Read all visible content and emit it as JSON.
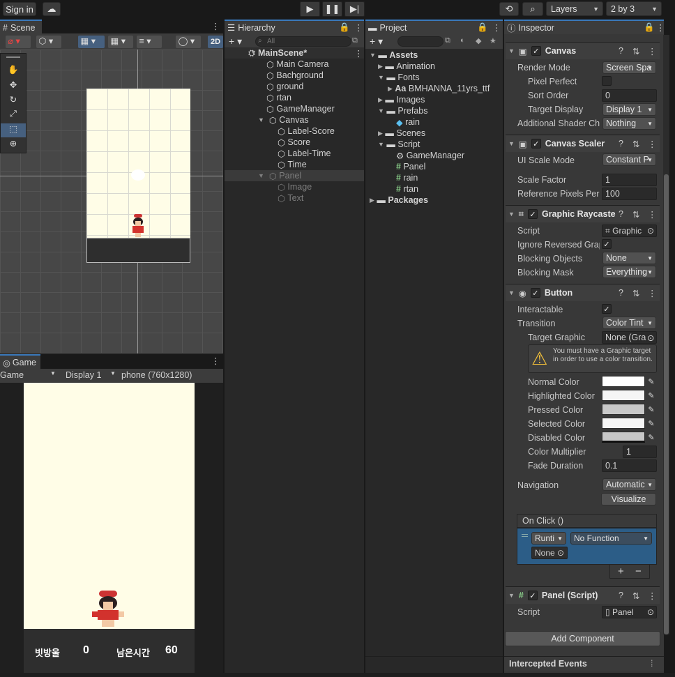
{
  "toolbar": {
    "sign_in": "Sign in",
    "layers": "Layers",
    "layout": "2 by 3"
  },
  "scene": {
    "tab": "Scene",
    "mode_2d": "2D"
  },
  "game": {
    "tab": "Game",
    "view": "Game",
    "display": "Display 1",
    "resolution": "phone (760x1280)",
    "hud": {
      "score_label": "빗방울",
      "score": "0",
      "time_label": "남은시간",
      "time": "60"
    }
  },
  "hierarchy": {
    "tab": "Hierarchy",
    "search_placeholder": "All",
    "scene_name": "MainScene*",
    "items": [
      "Main Camera",
      "Bachground",
      "ground",
      "rtan",
      "GameManager",
      "Canvas",
      "Label-Score",
      "Score",
      "Label-Time",
      "Time",
      "Panel",
      "Image",
      "Text"
    ]
  },
  "project": {
    "tab": "Project",
    "items": [
      "Assets",
      "Animation",
      "Fonts",
      "BMHANNA_11yrs_ttf",
      "Images",
      "Prefabs",
      "rain",
      "Scenes",
      "Script",
      "GameManager",
      "Panel",
      "rain",
      "rtan",
      "Packages"
    ],
    "font_prefix": "Aa"
  },
  "inspector": {
    "tab": "Inspector",
    "canvas": {
      "title": "Canvas",
      "render_mode_label": "Render Mode",
      "render_mode": "Screen Spa",
      "pixel_perfect": "Pixel Perfect",
      "sort_order_label": "Sort Order",
      "sort_order": "0",
      "target_display_label": "Target Display",
      "target_display": "Display 1",
      "shader_label": "Additional Shader Ch",
      "shader": "Nothing"
    },
    "scaler": {
      "title": "Canvas Scaler",
      "ui_scale_label": "UI Scale Mode",
      "ui_scale": "Constant P",
      "scale_factor_label": "Scale Factor",
      "scale_factor": "1",
      "ref_label": "Reference Pixels Per",
      "ref": "100"
    },
    "raycaster": {
      "title": "Graphic Raycaste",
      "script_label": "Script",
      "script": "Graphic",
      "ignore_label": "Ignore Reversed Grap",
      "blocking_label": "Blocking Objects",
      "blocking": "None",
      "mask_label": "Blocking Mask",
      "mask": "Everything"
    },
    "button": {
      "title": "Button",
      "interactable": "Interactable",
      "transition_label": "Transition",
      "transition": "Color Tint",
      "target_label": "Target Graphic",
      "target": "None (Gra",
      "warning": "You must have a Graphic target in order to use a color transition.",
      "normal": "Normal Color",
      "highlighted": "Highlighted Color",
      "pressed": "Pressed Color",
      "selected": "Selected Color",
      "disabled": "Disabled Color",
      "multiplier_label": "Color Multiplier",
      "multiplier": "1",
      "fade_label": "Fade Duration",
      "fade": "0.1",
      "nav_label": "Navigation",
      "nav": "Automatic",
      "visualize": "Visualize",
      "onclick": "On Click ()",
      "runtime": "Runti",
      "nofunc": "No Function",
      "none": "None",
      "plus": "+",
      "minus": "−"
    },
    "panel": {
      "title": "Panel (Script)",
      "script_label": "Script",
      "script": "Panel"
    },
    "add_component": "Add Component",
    "intercepted": "Intercepted Events"
  },
  "colors": {
    "accent": "#3a79bb",
    "game_bg": "#fffde7",
    "selection": "#2c5d87"
  }
}
